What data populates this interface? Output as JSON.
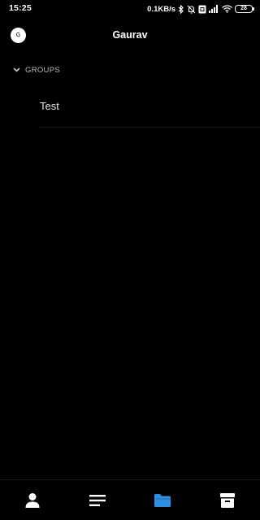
{
  "status_bar": {
    "time": "15:25",
    "speed": "0.1KB/s",
    "battery": "28",
    "icons": [
      "bluetooth-icon",
      "alarm-off-icon",
      "sim-icon",
      "signal-icon",
      "wifi-icon",
      "battery-icon"
    ]
  },
  "header": {
    "avatar_initial": "G",
    "title": "Gaurav"
  },
  "groups": {
    "section_label": "GROUPS",
    "expanded": true,
    "items": [
      {
        "label": "Test"
      }
    ]
  },
  "bottom_nav": {
    "tabs": [
      {
        "icon": "person-icon",
        "active": false
      },
      {
        "icon": "list-icon",
        "active": false
      },
      {
        "icon": "folder-icon",
        "active": true
      },
      {
        "icon": "archive-icon",
        "active": false
      }
    ],
    "active_color": "#2f8fe0",
    "inactive_color": "#ffffff"
  },
  "colors": {
    "background": "#000000",
    "text": "#ffffff",
    "accent": "#2f8fe0"
  }
}
